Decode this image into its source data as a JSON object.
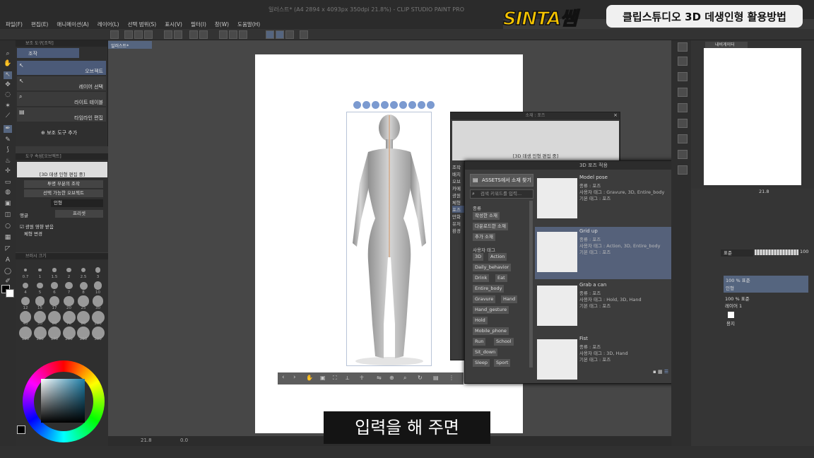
{
  "window": {
    "title": "일러스트* (A4 2894 x 4093px 350dpi 21.8%) - CLIP STUDIO PAINT PRO"
  },
  "overlay": {
    "logo": "SINTA쌤",
    "headline": "클립스튜디오 3D 데생인형 활용방법",
    "subtitle": "입력을 해 주면"
  },
  "menu": [
    "파일(F)",
    "편집(E)",
    "애니메이션(A)",
    "레이어(L)",
    "선택 범위(S)",
    "표시(V)",
    "필터(I)",
    "창(W)",
    "도움말(H)"
  ],
  "subtool": {
    "header": "보조 도구[조작]",
    "tab": "조작",
    "items": [
      "오브젝트",
      "레이어 선택",
      "라이트 테이블",
      "타임라인 편집"
    ],
    "add_label": "보조 도구 추가"
  },
  "toolprop": {
    "header": "도구 속성[오브젝트]",
    "mode": "[3D 데생 인형 편집 중]",
    "row1": "투명 부분의 조작",
    "row2": "선택 가능한 오브젝트",
    "row3": "인형",
    "row4": "앵글",
    "row4b": "프리셋",
    "row5": "광원 영향 받음",
    "row6": "체형 변경"
  },
  "brushsize": {
    "header": "브러시 크기",
    "sizes": [
      "0.7",
      "1",
      "1.5",
      "2",
      "2.5",
      "3",
      "4",
      "5",
      "6",
      "7",
      "8",
      "10",
      "12",
      "15",
      "17",
      "20",
      "25",
      "30",
      "40",
      "50",
      "60",
      "70",
      "80",
      "100",
      "120",
      "150",
      "170",
      "200",
      "250",
      "300"
    ]
  },
  "colors": {
    "accent": "#f5c400",
    "selection": "#4b5a78",
    "canvas_bg": "#474747"
  },
  "document": {
    "tab": "일러스트*"
  },
  "materials_window": {
    "title": "소재 : 포즈",
    "preview_caption": "[3D 데생 인형 편집 중]",
    "side_labels": [
      "조작",
      "배치",
      "오브",
      "카메",
      "광원",
      "체형",
      "포즈",
      "만화",
      "유저",
      "환경"
    ]
  },
  "pose_dialog": {
    "title": "3D 포즈 적용",
    "assets_button": "ASSETS에서 소재 찾기",
    "search_placeholder": "검색 키워드를 입력...",
    "type_label": "종류",
    "type_tags": [
      "작성한 소재",
      "다운로드한 소재",
      "추가 소재"
    ],
    "user_tag_label": "사용자 태그",
    "user_tags": [
      "3D",
      "Action",
      "Daily_behavior",
      "Drink",
      "Eat",
      "Entire_body",
      "Gravure",
      "Hand",
      "Hand_gesture",
      "Hold",
      "Mobile_phone",
      "Run",
      "School",
      "Sit_down",
      "Sleep",
      "Sport"
    ],
    "ok": "OK",
    "cancel": "취소",
    "poses": [
      {
        "name": "Model pose",
        "kind": "종류 : 포즈",
        "user_tags": "사용자 태그 : Gravure, 3D, Entire_body",
        "default_tags": "기본 태그 : 포즈"
      },
      {
        "name": "Grid up",
        "kind": "종류 : 포즈",
        "user_tags": "사용자 태그 : Action, 3D, Entire_body",
        "default_tags": "기본 태그 : 포즈"
      },
      {
        "name": "Grab a can",
        "kind": "종류 : 포즈",
        "user_tags": "사용자 태그 : Hold, 3D, Hand",
        "default_tags": "기본 태그 : 포즈"
      },
      {
        "name": "Fist",
        "kind": "종류 : 포즈",
        "user_tags": "사용자 태그 : 3D, Hand",
        "default_tags": "기본 태그 : 포즈"
      }
    ]
  },
  "navigator": {
    "tab": "내비게이터",
    "zoom": "21.8",
    "angle": "0.0"
  },
  "layers": {
    "blend": "표준",
    "opacity": "100",
    "items": [
      {
        "label": "100 % 표준",
        "name": "인형"
      },
      {
        "label": "100 % 표준",
        "name": "레이어 1"
      },
      {
        "label": "",
        "name": "용지"
      }
    ]
  },
  "status": {
    "zoom": "21.8",
    "angle": "0.0"
  }
}
